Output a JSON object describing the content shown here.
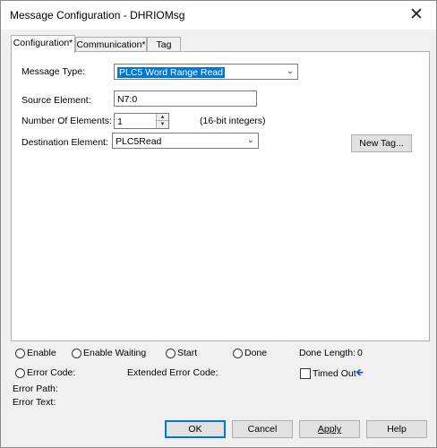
{
  "window": {
    "title": "Message Configuration - DHRIOMsg",
    "close_symbol": "✕"
  },
  "tabs": [
    {
      "label": "Configuration*"
    },
    {
      "label": "Communication*"
    },
    {
      "label": "Tag"
    }
  ],
  "config": {
    "message_type_label": "Message Type:",
    "message_type_value": "PLC5 Word Range Read",
    "source_label": "Source Element:",
    "source_value": "N7:0",
    "num_elements_label": "Number Of Elements:",
    "num_elements_value": "1",
    "num_elements_unit": "(16-bit integers)",
    "dest_label": "Destination Element:",
    "dest_value": "PLC5Read",
    "new_tag_button": "New Tag..."
  },
  "status": {
    "enable": "Enable",
    "enable_waiting": "Enable Waiting",
    "start": "Start",
    "done": "Done",
    "done_length_label": "Done Length:",
    "done_length_value": "0",
    "error_code": "Error Code:",
    "extended_error_code": "Extended Error Code:",
    "timed_out": "Timed Out",
    "error_path": "Error Path:",
    "error_text": "Error Text:"
  },
  "buttons": {
    "ok": "OK",
    "cancel": "Cancel",
    "apply": "Apply",
    "help": "Help"
  },
  "icons": {
    "dropdown": "chevron-down-icon",
    "timed_out_arrow": "arrow-left-icon"
  },
  "colors": {
    "accent": "#0078d7",
    "arrow": "#1f4fd6"
  }
}
